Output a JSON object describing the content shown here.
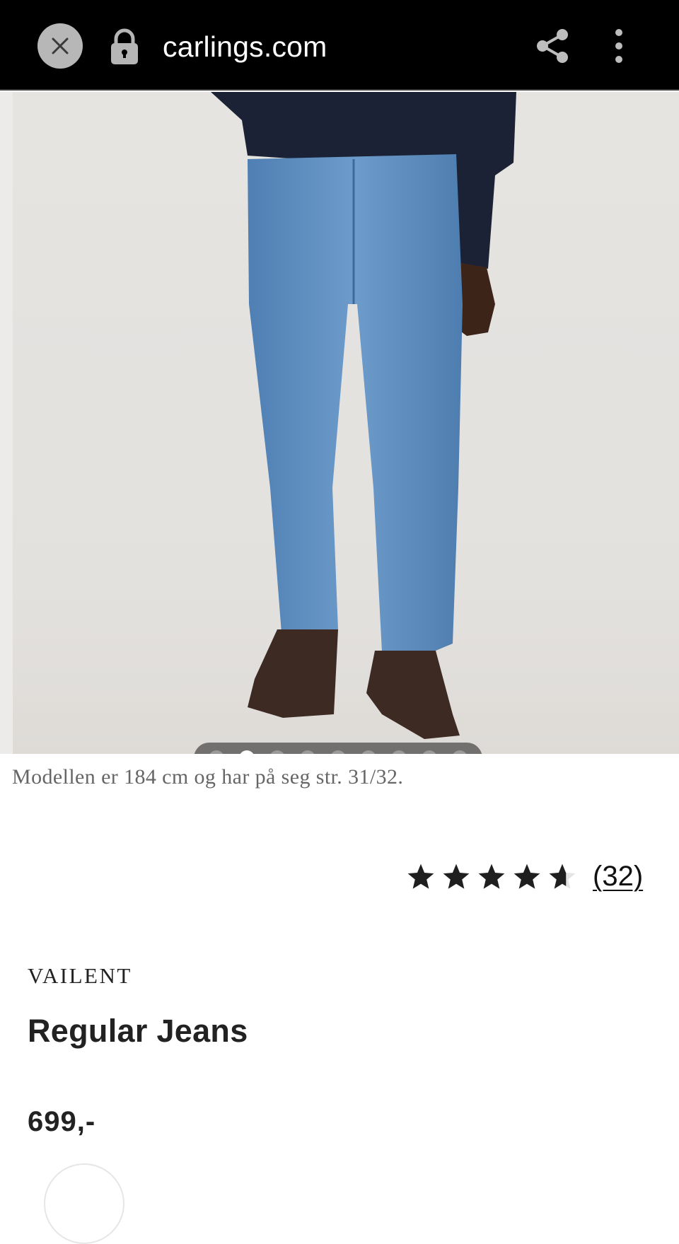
{
  "browser": {
    "url": "carlings.com"
  },
  "gallery": {
    "image_alt": "Regular Jeans",
    "dots_total": 9,
    "active_dot": 1
  },
  "product": {
    "model_caption": "Modellen er 184 cm og har på seg str. 31/32.",
    "rating": {
      "value": 4.5,
      "max": 5,
      "count_label": "(32)"
    },
    "brand": "VAILENT",
    "name": "Regular Jeans",
    "price": "699,-"
  },
  "colors": {
    "topbar": "#000000",
    "accent_star": "#1f1f1f",
    "caption_text": "#666666"
  },
  "icons": {
    "close": "close-icon",
    "lock": "lock-icon",
    "share": "share-icon",
    "more": "more-vertical-icon",
    "star": "star-icon"
  }
}
